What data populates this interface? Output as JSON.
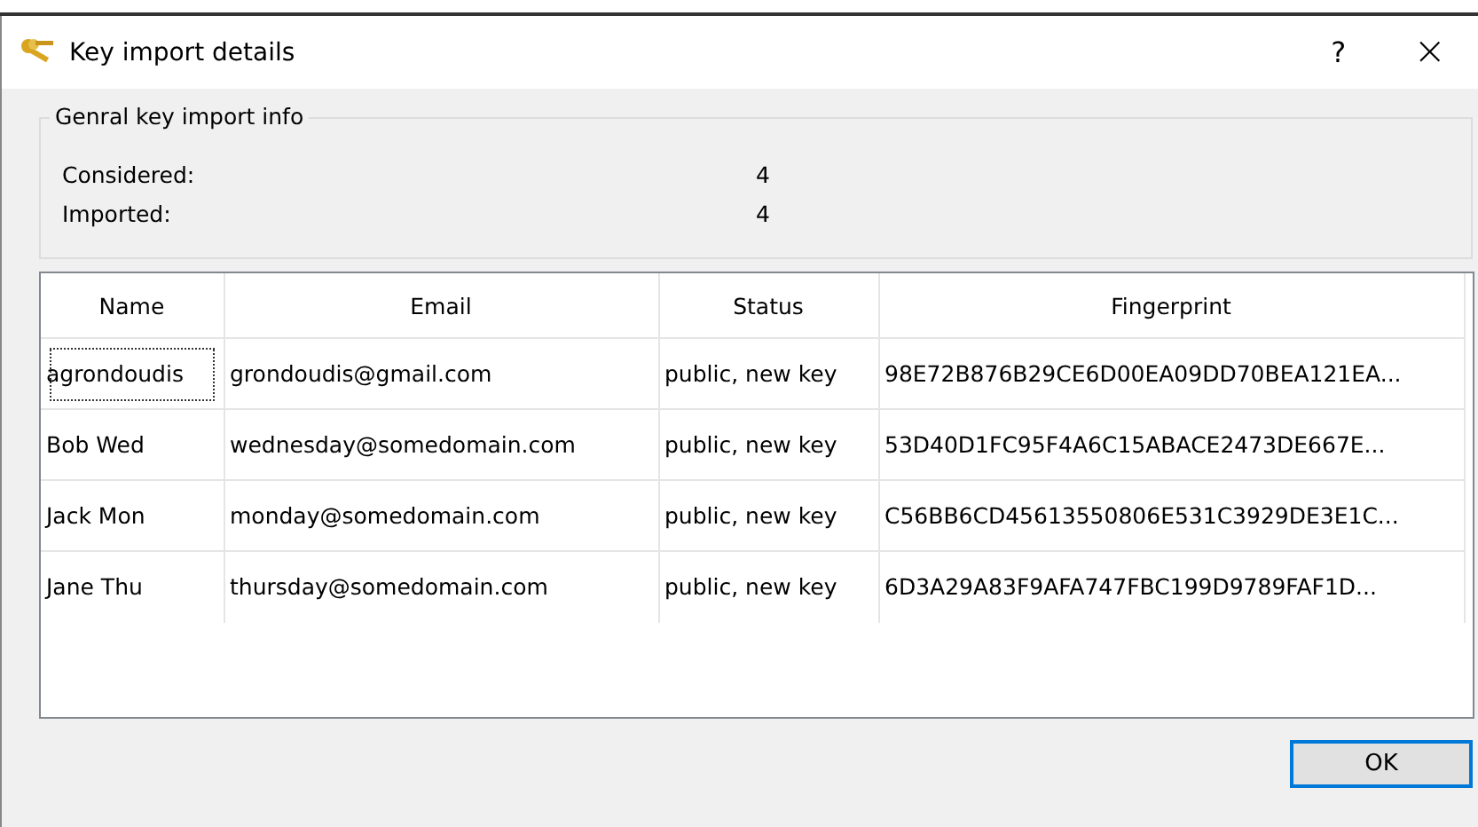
{
  "window": {
    "title": "Key import details",
    "help": "?",
    "close": "×"
  },
  "info_group": {
    "title": "Genral key import info",
    "fields": [
      {
        "label": "Considered:",
        "value": "4"
      },
      {
        "label": "Imported:",
        "value": "4"
      }
    ]
  },
  "table": {
    "columns": [
      "Name",
      "Email",
      "Status",
      "Fingerprint"
    ],
    "rows": [
      {
        "focused": true,
        "cells": [
          "agrondoudis",
          "grondoudis@gmail.com",
          "public, new key",
          "98E72B876B29CE6D00EA09DD70BEA121EA..."
        ]
      },
      {
        "focused": false,
        "cells": [
          "Bob Wed",
          "wednesday@somedomain.com",
          "public, new key",
          "53D40D1FC95F4A6C15ABACE2473DE667E..."
        ]
      },
      {
        "focused": false,
        "cells": [
          "Jack Mon",
          "monday@somedomain.com",
          "public, new key",
          "C56BB6CD45613550806E531C3929DE3E1C..."
        ]
      },
      {
        "focused": false,
        "cells": [
          "Jane Thu",
          "thursday@somedomain.com",
          "public, new key",
          "6D3A29A83F9AFA747FBC199D9789FAF1D..."
        ]
      }
    ]
  },
  "buttons": [
    "OK"
  ]
}
